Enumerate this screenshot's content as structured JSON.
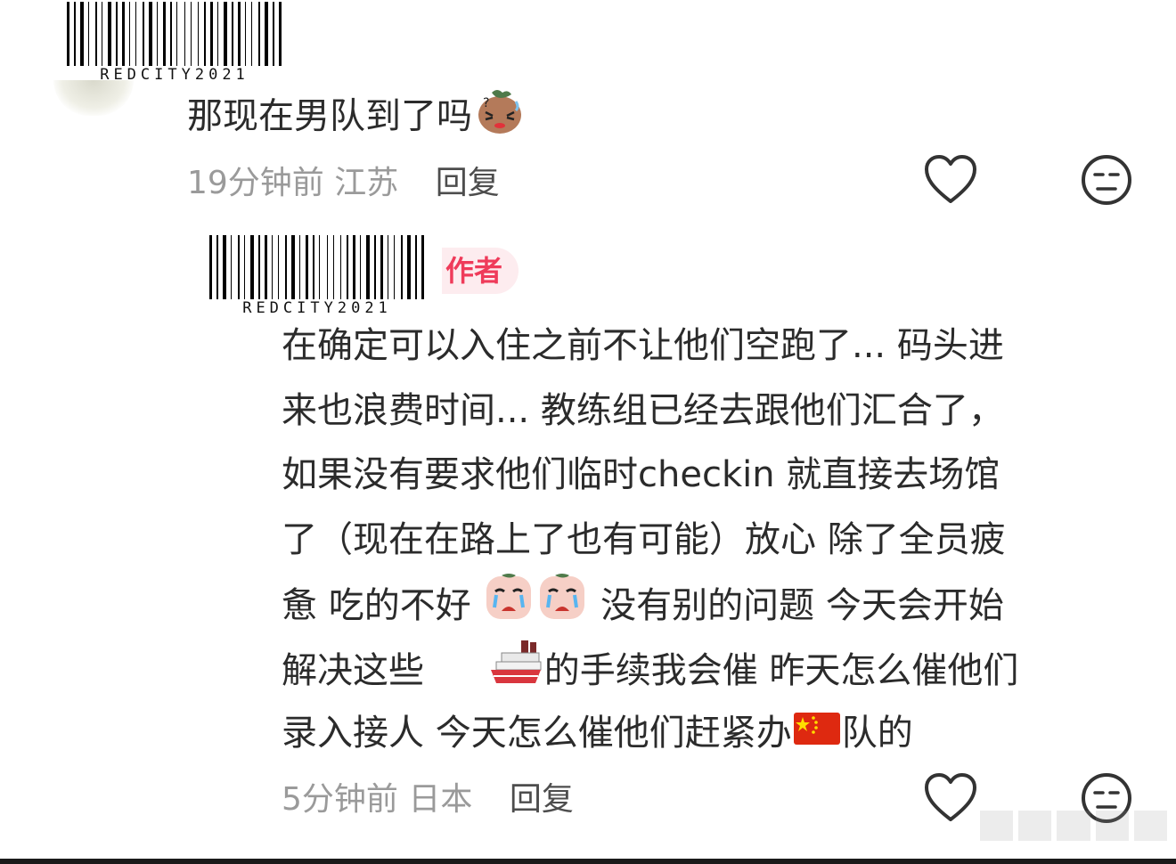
{
  "watermark_codes": [
    "REDCITY2021",
    "REDCITY2021"
  ],
  "comment1": {
    "text": "那现在男队到了吗",
    "sticker": "nervous-sweet-potato-sticker",
    "time": "19分钟前",
    "location": "江苏",
    "reply_label": "回复",
    "like_icon": "heart-icon",
    "dislike_icon": "meh-face-icon"
  },
  "comment2": {
    "author_badge": "作者",
    "lines": [
      "在确定可以入住之前不让他们空跑了... 码头进",
      "来也浪费时间... 教练组已经去跟他们汇合了，",
      "如果没有要求他们临时checkin 就直接去场馆",
      "了（现在在路上了也有可能）放心  除了全员疲",
      "惫  吃的不好",
      "没有别的问题  今天会开始",
      "解决这些",
      "的手续我会催 昨天怎么催他们",
      "录入接人 今天怎么催他们赶紧办",
      "队的"
    ],
    "stickers": [
      "crying-sticker",
      "crying-sticker",
      "ship-emoji",
      "china-flag-emoji"
    ],
    "time": "5分钟前",
    "location": "日本",
    "reply_label": "回复",
    "like_icon": "heart-icon",
    "dislike_icon": "meh-face-icon"
  }
}
